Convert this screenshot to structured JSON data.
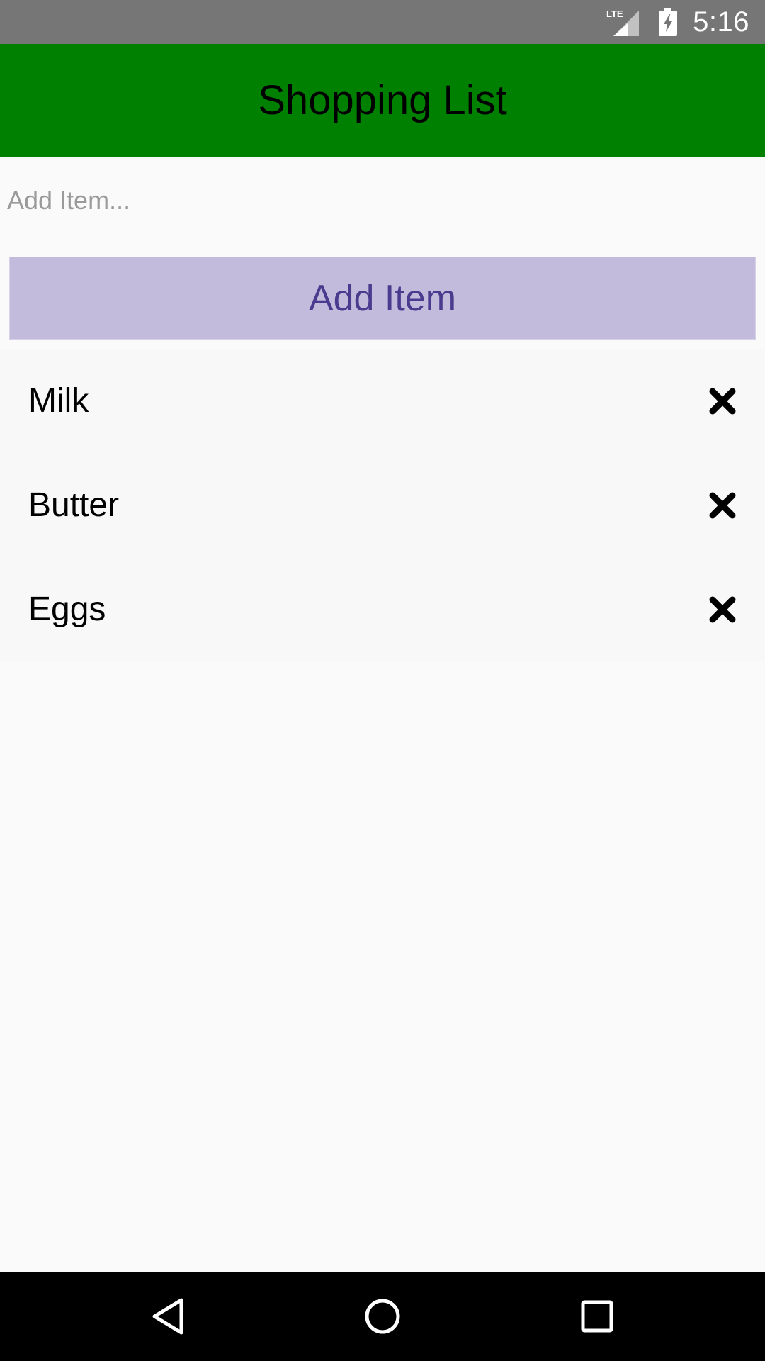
{
  "status_bar": {
    "network_label": "LTE",
    "time": "5:16",
    "icons": [
      "lte-signal-icon",
      "battery-charging-icon"
    ],
    "background_color": "#767676"
  },
  "app_bar": {
    "title": "Shopping List",
    "background_color": "#008000"
  },
  "add_form": {
    "input_value": "",
    "input_placeholder": "Add Item...",
    "button_label": "Add Item",
    "button_color": "#c3bbdc",
    "button_text_color": "#4a3b8f"
  },
  "items": [
    {
      "label": "Milk",
      "remove_icon": "close-icon"
    },
    {
      "label": "Butter",
      "remove_icon": "close-icon"
    },
    {
      "label": "Eggs",
      "remove_icon": "close-icon"
    }
  ],
  "nav_bar": {
    "buttons": [
      "back-icon",
      "home-icon",
      "recents-icon"
    ]
  }
}
